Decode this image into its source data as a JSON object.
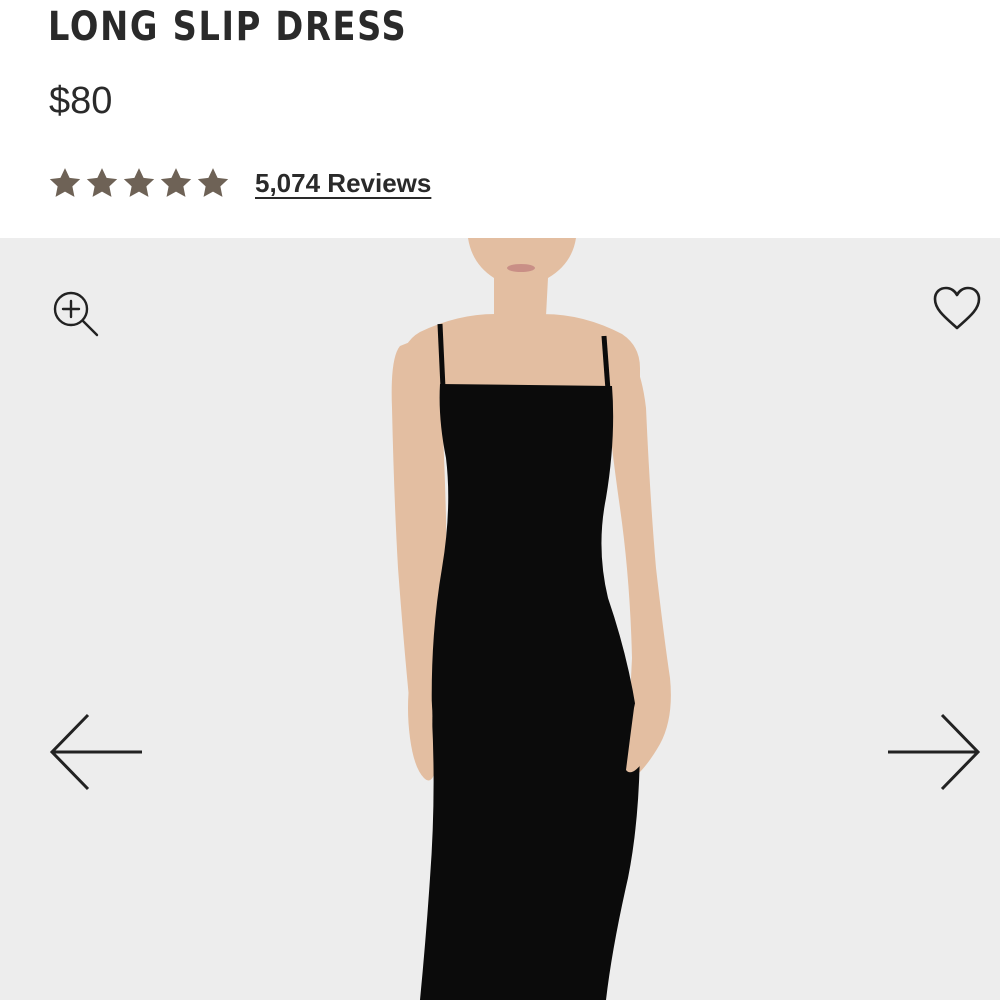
{
  "product": {
    "title": "LONG SLIP DRESS",
    "price": "$80",
    "rating": {
      "stars": 5,
      "reviews_label": "5,074 Reviews"
    }
  },
  "gallery": {
    "image": "model-wearing-black-long-slip-dress",
    "controls": {
      "zoom": "zoom-in-icon",
      "wishlist": "heart-icon",
      "previous": "arrow-left-icon",
      "next": "arrow-right-icon"
    }
  },
  "colors": {
    "text": "#2a2a2a",
    "star": "#6e6256",
    "gallery_background": "#ededed",
    "dress": "#0b0b0b",
    "skin": "#e3bea1"
  }
}
